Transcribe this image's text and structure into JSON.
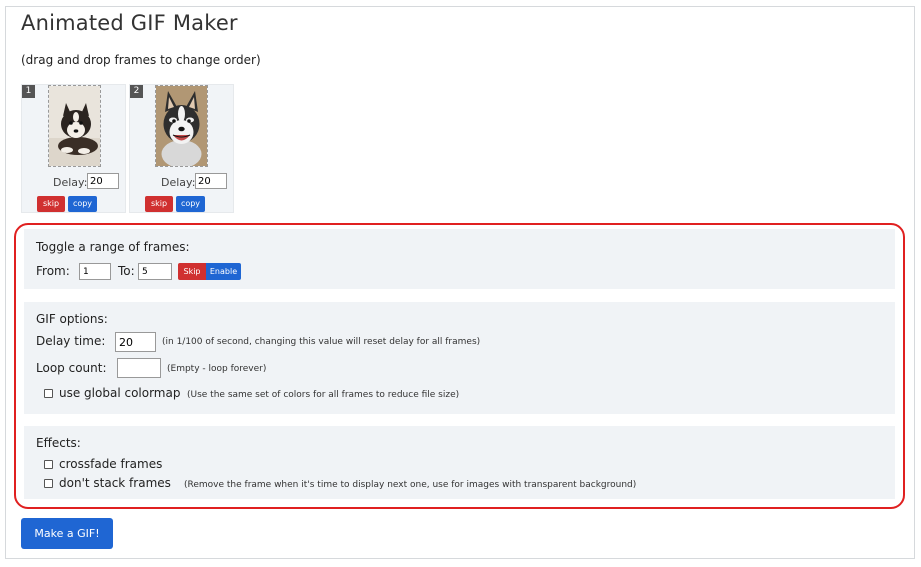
{
  "app": {
    "title": "Animated GIF Maker",
    "subtitle": "(drag and drop frames to change order)"
  },
  "frames": [
    {
      "number": "1",
      "image": "husky-puppy-lying",
      "delay_label": "Delay:",
      "delay_value": "20",
      "skip_label": "skip",
      "copy_label": "copy"
    },
    {
      "number": "2",
      "image": "husky-smiling",
      "delay_label": "Delay:",
      "delay_value": "20",
      "skip_label": "skip",
      "copy_label": "copy"
    }
  ],
  "range": {
    "title": "Toggle a range of frames:",
    "from_label": "From:",
    "from_value": "1",
    "to_label": "To:",
    "to_value": "5",
    "skip_label": "Skip",
    "enable_label": "Enable"
  },
  "gif_options": {
    "title": "GIF options:",
    "delay_label": "Delay time:",
    "delay_value": "20",
    "delay_hint": "(in 1/100 of second, changing this value will reset delay for all frames)",
    "loop_label": "Loop count:",
    "loop_value": "",
    "loop_hint": "(Empty - loop forever)",
    "colormap_label": "use global colormap",
    "colormap_hint": "(Use the same set of colors for all frames to reduce file size)"
  },
  "effects": {
    "title": "Effects:",
    "crossfade_label": "crossfade frames",
    "nostack_label": "don't stack frames",
    "nostack_hint": "(Remove the frame when it's time to display next one, use for images with transparent background)"
  },
  "make_button": "Make a GIF!",
  "colors": {
    "primary": "#1f66d3",
    "danger": "#d03030",
    "highlight": "#e02020",
    "section_bg": "#f0f3f6"
  }
}
